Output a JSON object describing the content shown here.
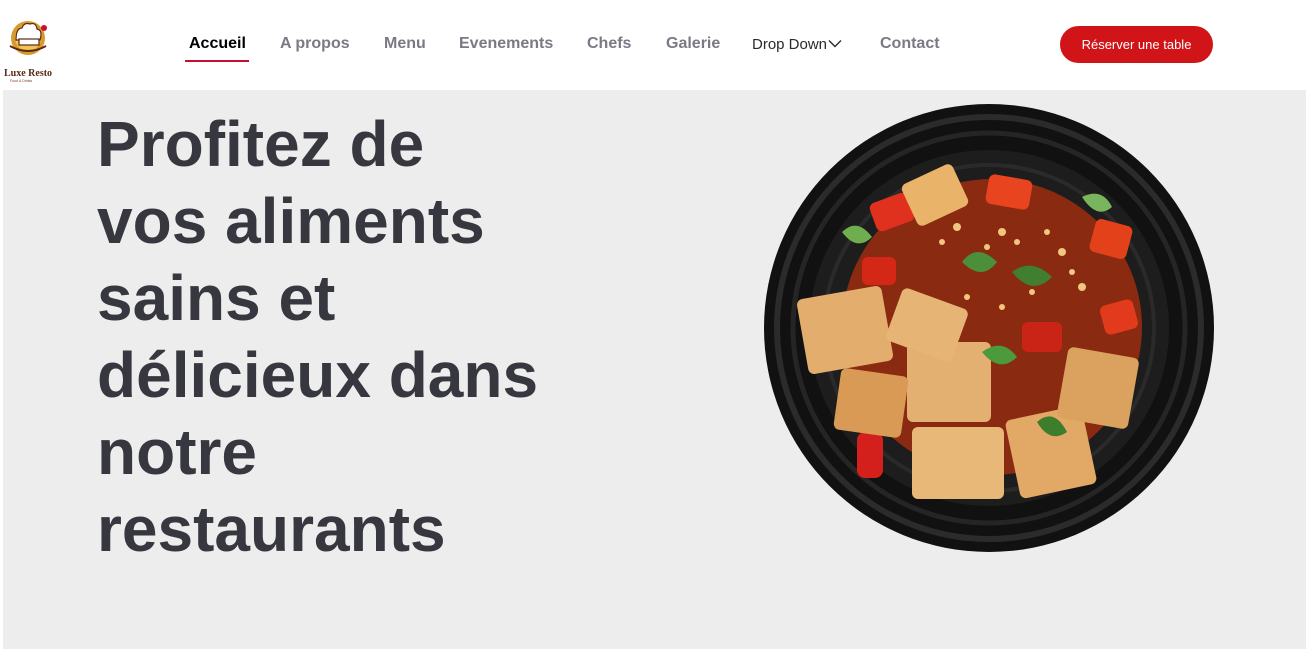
{
  "brand": {
    "name": "Luxe Resto",
    "tagline": "Food & Drinks"
  },
  "nav": {
    "items": [
      {
        "label": "Accueil",
        "active": true
      },
      {
        "label": "A propos",
        "active": false
      },
      {
        "label": "Menu",
        "active": false
      },
      {
        "label": "Evenements",
        "active": false
      },
      {
        "label": "Chefs",
        "active": false
      },
      {
        "label": "Galerie",
        "active": false
      },
      {
        "label": "Drop Down",
        "active": false,
        "has_dropdown": true
      },
      {
        "label": "Contact",
        "active": false
      }
    ],
    "cta_label": "Réserver une table"
  },
  "hero": {
    "title_lines": [
      "Profitez de",
      "vos aliments",
      "sains et",
      "délicieux dans",
      "notre",
      "restaurants"
    ],
    "image_alt": "bowl-of-food-image"
  },
  "colors": {
    "accent": "#d11417",
    "title_text": "#37373f",
    "nav_text": "#7a7a85",
    "hero_bg": "#ededed"
  }
}
